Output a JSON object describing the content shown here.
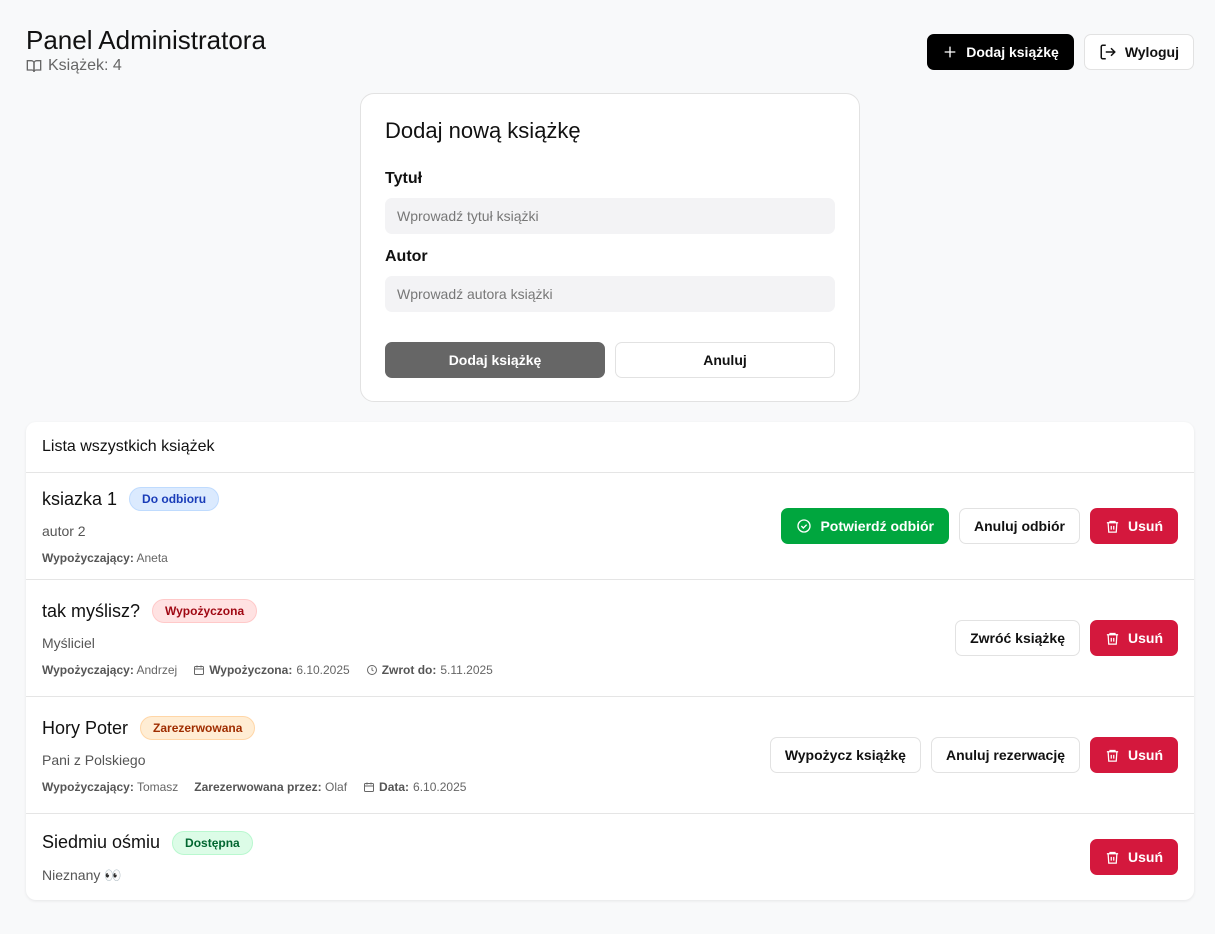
{
  "header": {
    "title": "Panel Administratora",
    "count_label": "Książek: 4",
    "add_label": "Dodaj książkę",
    "logout_label": "Wyloguj"
  },
  "form": {
    "title": "Dodaj nową książkę",
    "title_label": "Tytuł",
    "title_placeholder": "Wprowadź tytuł książki",
    "author_label": "Autor",
    "author_placeholder": "Wprowadź autora książki",
    "submit_label": "Dodaj książkę",
    "cancel_label": "Anuluj"
  },
  "list": {
    "header": "Lista wszystkich książek",
    "books": [
      {
        "title": "ksiazka 1",
        "status": "Do odbioru",
        "author": "autor 2",
        "borrower_label": "Wypożyczający:",
        "borrower": "Aneta",
        "actions": [
          "Potwierdź odbiór",
          "Anuluj odbiór",
          "Usuń"
        ]
      },
      {
        "title": "tak myślisz?",
        "status": "Wypożyczona",
        "author": "Myśliciel",
        "borrower_label": "Wypożyczający:",
        "borrower": "Andrzej",
        "borrowed_label": "Wypożyczona:",
        "borrowed": "6.10.2025",
        "due_label": "Zwrot do:",
        "due": "5.11.2025",
        "actions": [
          "Zwróć książkę",
          "Usuń"
        ]
      },
      {
        "title": "Hory Poter",
        "status": "Zarezerwowana",
        "author": "Pani z Polskiego",
        "borrower_label": "Wypożyczający:",
        "borrower": "Tomasz",
        "reserved_label": "Zarezerwowana przez:",
        "reserved": "Olaf",
        "date_label": "Data:",
        "date": "6.10.2025",
        "actions": [
          "Wypożycz książkę",
          "Anuluj rezerwację",
          "Usuń"
        ]
      },
      {
        "title": "Siedmiu ośmiu",
        "status": "Dostępna",
        "author": "Nieznany 👀",
        "actions": [
          "Usuń"
        ]
      }
    ]
  },
  "colors": {
    "green": "#00a63e",
    "red": "#d4183d",
    "blue_badge": "#dbeafe",
    "red_badge": "#ffe2e2",
    "orange_badge": "#ffedd4",
    "green_badge": "#dcfce7"
  }
}
